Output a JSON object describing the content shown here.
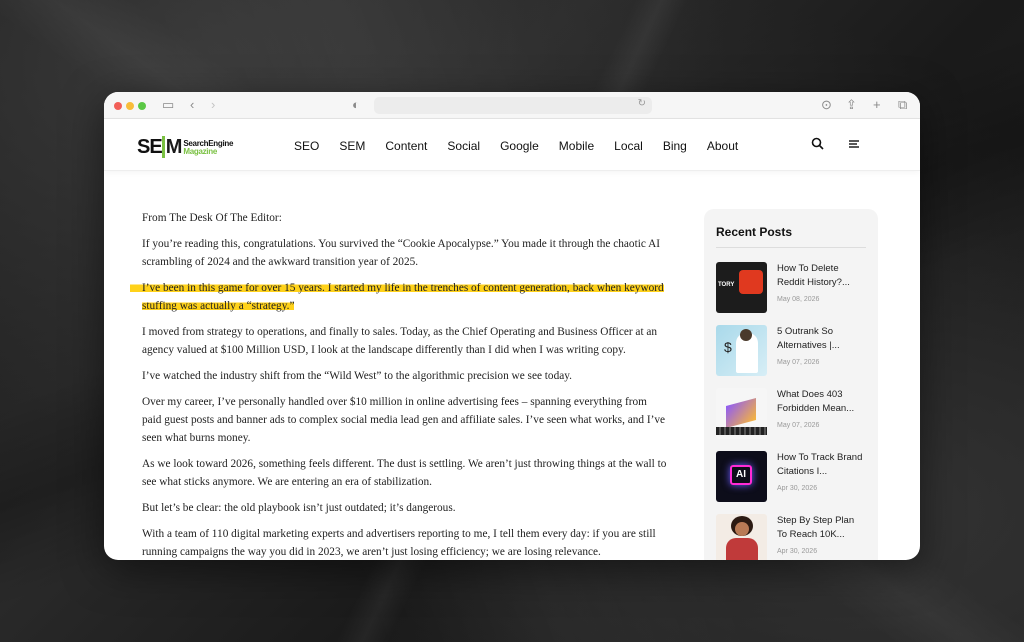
{
  "browser": {
    "icons": [
      "sidebar-icon",
      "back-icon",
      "forward-icon",
      "privacy-icon",
      "reload-icon",
      "download-icon",
      "share-icon",
      "new-tab-icon",
      "tabs-overview-icon"
    ]
  },
  "site": {
    "logo_mark": "SE",
    "logo_mark_m": "M",
    "logo_line1": "SearchEngine",
    "logo_line2": "Magazine",
    "accent_color": "#7ac142",
    "nav": [
      "SEO",
      "SEM",
      "Content",
      "Social",
      "Google",
      "Mobile",
      "Local",
      "Bing",
      "About"
    ]
  },
  "article": {
    "paragraphs": [
      "From The Desk Of The Editor:",
      "If you’re reading this, congratulations. You survived the “Cookie Apocalypse.” You made it through the chaotic AI scrambling of 2024 and the awkward transition year of 2025.",
      "I’ve been in this game for over 15 years. I started my life in the trenches of content generation, back when keyword stuffing was actually a “strategy.”",
      "I moved from strategy to operations, and finally to sales. Today, as the Chief Operating and Business Officer at an agency valued at $100 Million USD, I look at the landscape differently than I did when I was writing copy.",
      "I’ve watched the industry shift from the “Wild West” to the algorithmic precision we see today.",
      "Over my career, I’ve personally handled over $10 million in online advertising fees – spanning everything from paid guest posts and banner ads to complex social media lead gen and affiliate sales. I’ve seen what works, and I’ve seen what burns money.",
      "As we look toward 2026, something feels different. The dust is settling. We aren’t just throwing things at the wall to see what sticks anymore. We are entering an era of stabilization.",
      "But let’s be clear: the old playbook isn’t just outdated; it’s dangerous.",
      "With a team of 110 digital marketing experts and advertisers reporting to me, I tell them every day: if you are still running campaigns the way you did in 2023, we aren’t just losing efficiency; we are losing relevance."
    ],
    "highlight_color": "#ffd21a"
  },
  "sidebar": {
    "title": "Recent Posts",
    "posts": [
      {
        "title": "How To Delete Reddit History?...",
        "date": "May 08, 2026",
        "thumb_text": "TORY"
      },
      {
        "title": "5 Outrank So Alternatives |...",
        "date": "May 07, 2026",
        "thumb_text": "$"
      },
      {
        "title": "What Does 403 Forbidden Mean...",
        "date": "May 07, 2026",
        "thumb_text": ""
      },
      {
        "title": "How To Track Brand Citations I...",
        "date": "Apr 30, 2026",
        "thumb_text": "AI"
      },
      {
        "title": "Step By Step Plan To Reach 10K...",
        "date": "Apr 30, 2026",
        "thumb_text": ""
      }
    ]
  }
}
